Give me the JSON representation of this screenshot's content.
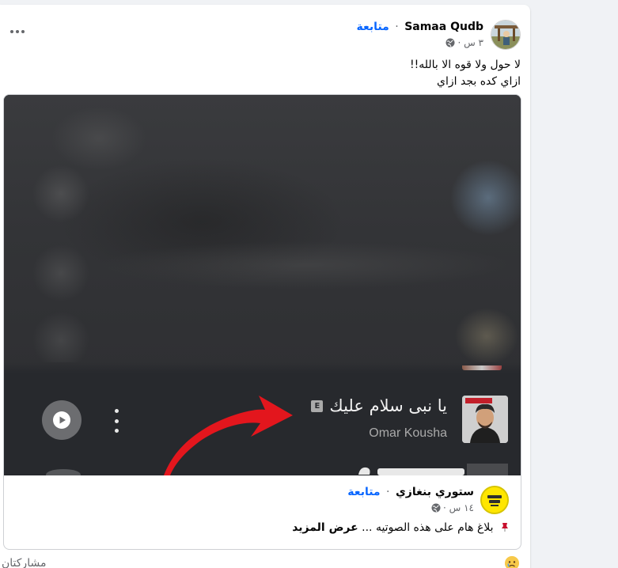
{
  "post": {
    "author_name": "Samaa Qudb",
    "separator": "·",
    "follow_label": "متابعة",
    "time": "٣ س ·",
    "text_line1": "لا حول ولا قوه الا بالله!!",
    "text_line2": "ازاي كده بجد ازاي",
    "more_icon": "more-horizontal-icon"
  },
  "shared_post": {
    "media": {
      "song_title": "يا نبى سلام عليك",
      "explicit_badge": "E",
      "artist": "Omar Kousha"
    },
    "author_name": "ستوري بنغازي",
    "separator": "·",
    "follow_label": "متابعة",
    "time": "١٤ س ·",
    "text": "بلاغ هام على هذه الصوتيه ...",
    "see_more": "عرض المزيد"
  },
  "footer": {
    "shares_label": "مشاركتان"
  },
  "colors": {
    "accent": "#0866ff",
    "arrow": "#e3161d",
    "media_bg": "#27292d"
  }
}
